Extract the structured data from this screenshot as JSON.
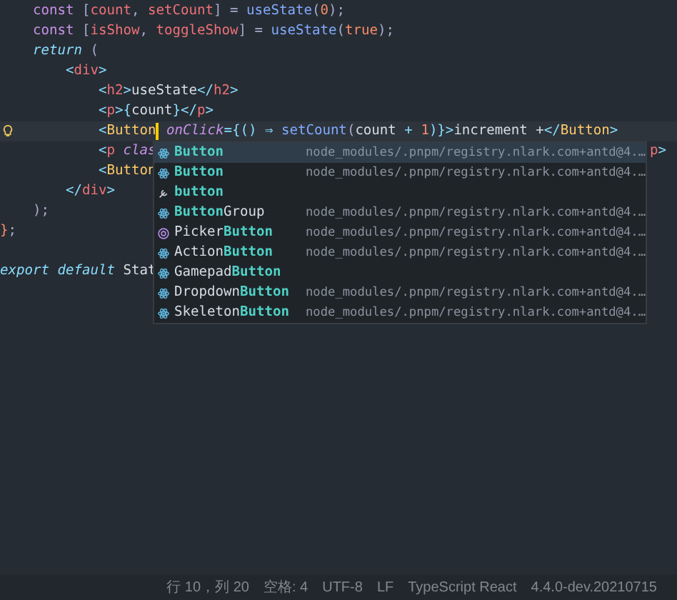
{
  "editor": {
    "lines": [
      {
        "tokens": [
          {
            "text": "    const",
            "kind": "keyword"
          },
          {
            "text": " [",
            "kind": "punct"
          },
          {
            "text": "count",
            "kind": "variable"
          },
          {
            "text": ", ",
            "kind": "punct"
          },
          {
            "text": "setCount",
            "kind": "variable"
          },
          {
            "text": "] = ",
            "kind": "punct"
          },
          {
            "text": "useState",
            "kind": "function"
          },
          {
            "text": "(",
            "kind": "punct"
          },
          {
            "text": "0",
            "kind": "number"
          },
          {
            "text": ");",
            "kind": "punct"
          }
        ]
      },
      {
        "tokens": [
          {
            "text": "    const",
            "kind": "keyword"
          },
          {
            "text": " [",
            "kind": "punct"
          },
          {
            "text": "isShow",
            "kind": "variable"
          },
          {
            "text": ", ",
            "kind": "punct"
          },
          {
            "text": "toggleShow",
            "kind": "variable"
          },
          {
            "text": "] = ",
            "kind": "punct"
          },
          {
            "text": "useState",
            "kind": "function"
          },
          {
            "text": "(",
            "kind": "punct"
          },
          {
            "text": "true",
            "kind": "number"
          },
          {
            "text": ");",
            "kind": "punct"
          }
        ]
      },
      {
        "tokens": [
          {
            "text": "    return",
            "kind": "keyword-italic"
          },
          {
            "text": " (",
            "kind": "punct"
          }
        ]
      },
      {
        "tokens": [
          {
            "text": "        <",
            "kind": "bracket"
          },
          {
            "text": "div",
            "kind": "tag"
          },
          {
            "text": ">",
            "kind": "bracket"
          }
        ]
      },
      {
        "tokens": [
          {
            "text": "            <",
            "kind": "bracket"
          },
          {
            "text": "h2",
            "kind": "tag"
          },
          {
            "text": ">",
            "kind": "bracket"
          },
          {
            "text": "useState",
            "kind": "plain"
          },
          {
            "text": "</",
            "kind": "bracket"
          },
          {
            "text": "h2",
            "kind": "tag"
          },
          {
            "text": ">",
            "kind": "bracket"
          }
        ]
      },
      {
        "tokens": [
          {
            "text": "            <",
            "kind": "bracket"
          },
          {
            "text": "p",
            "kind": "tag"
          },
          {
            "text": ">{",
            "kind": "bracket"
          },
          {
            "text": "count",
            "kind": "plain"
          },
          {
            "text": "}</",
            "kind": "bracket"
          },
          {
            "text": "p",
            "kind": "tag"
          },
          {
            "text": ">",
            "kind": "bracket"
          }
        ]
      },
      {
        "current": true,
        "lightbulb": true,
        "tokens": [
          {
            "text": "            <",
            "kind": "bracket"
          },
          {
            "text": "Button",
            "kind": "component",
            "caret_after": true
          },
          {
            "text": " onClick",
            "kind": "attr"
          },
          {
            "text": "={() ⇒ ",
            "kind": "bracket"
          },
          {
            "text": "setCount",
            "kind": "function"
          },
          {
            "text": "(",
            "kind": "punct"
          },
          {
            "text": "count",
            "kind": "plain"
          },
          {
            "text": " + ",
            "kind": "bracket"
          },
          {
            "text": "1",
            "kind": "number"
          },
          {
            "text": ")}>",
            "kind": "bracket"
          },
          {
            "text": "increment +",
            "kind": "plain"
          },
          {
            "text": "</",
            "kind": "bracket"
          },
          {
            "text": "Button",
            "kind": "component"
          },
          {
            "text": ">",
            "kind": "bracket"
          }
        ]
      },
      {
        "tokens": [
          {
            "text": "            <",
            "kind": "bracket"
          },
          {
            "text": "p",
            "kind": "tag"
          },
          {
            "text": " clas",
            "kind": "attr"
          }
        ],
        "tail": [
          {
            "text": "p",
            "kind": "tag"
          },
          {
            "text": ">",
            "kind": "bracket"
          }
        ]
      },
      {
        "tokens": [
          {
            "text": "            <",
            "kind": "bracket"
          },
          {
            "text": "Button",
            "kind": "component"
          }
        ]
      },
      {
        "tokens": [
          {
            "text": "        </",
            "kind": "bracket"
          },
          {
            "text": "div",
            "kind": "tag"
          },
          {
            "text": ">",
            "kind": "bracket"
          }
        ]
      },
      {
        "tokens": [
          {
            "text": "    );",
            "kind": "punct"
          }
        ]
      },
      {
        "tokens": [
          {
            "text": "}",
            "kind": "number"
          },
          {
            "text": ";",
            "kind": "punct"
          }
        ]
      },
      {
        "tokens": [
          {
            "text": "export default",
            "kind": "keyword-italic"
          },
          {
            "text": " Stat",
            "kind": "plain"
          }
        ]
      }
    ]
  },
  "suggestions": [
    {
      "kind": "component",
      "match": "Button",
      "detail": "node_modules/.pnpm/registry.nlark.com+antd@4.…",
      "selected": true
    },
    {
      "kind": "component",
      "match": "Button",
      "detail": "node_modules/.pnpm/registry.nlark.com+antd@4.…",
      "selected": false
    },
    {
      "kind": "element",
      "match": "button",
      "selected": false
    },
    {
      "kind": "component",
      "match": "Button",
      "after": "Group",
      "detail": "node_modules/.pnpm/registry.nlark.com+antd@4.…",
      "selected": false
    },
    {
      "kind": "class",
      "before": "Picker",
      "match": "Button",
      "detail": "node_modules/.pnpm/registry.nlark.com+antd@4.…",
      "selected": false
    },
    {
      "kind": "component",
      "before": "Action",
      "match": "Button",
      "detail": "node_modules/.pnpm/registry.nlark.com+antd@4.…",
      "selected": false
    },
    {
      "kind": "component",
      "before": "Gamepad",
      "match": "Button",
      "selected": false
    },
    {
      "kind": "component",
      "before": "Dropdown",
      "match": "Button",
      "detail": "node_modules/.pnpm/registry.nlark.com+antd@4.…",
      "selected": false
    },
    {
      "kind": "component",
      "before": "Skeleton",
      "match": "Button",
      "detail": "node_modules/.pnpm/registry.nlark.com+antd@4.…",
      "selected": false
    }
  ],
  "status_bar": [
    "行 10，列 20",
    "空格: 4",
    "UTF-8",
    "LF",
    "TypeScript React",
    "4.4.0-dev.20210715"
  ]
}
